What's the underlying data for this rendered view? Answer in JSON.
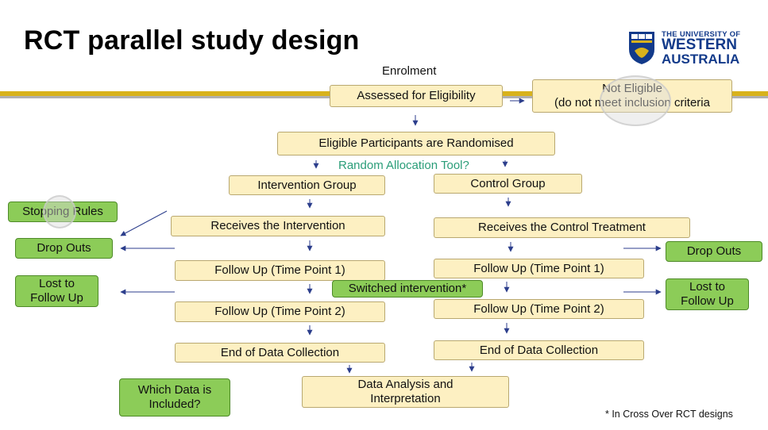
{
  "title": "RCT parallel study design",
  "logo": {
    "line1": "THE UNIVERSITY OF",
    "line2": "WESTERN",
    "line3": "AUSTRALIA"
  },
  "flow": {
    "enrolment": "Enrolment",
    "assessed": "Assessed for Eligibility",
    "not_eligible_1": "Not Eligible",
    "not_eligible_2": "(do not meet inclusion criteria",
    "randomised": "Eligible Participants are Randomised",
    "random_tool": "Random Allocation Tool?",
    "intervention_group": "Intervention Group",
    "control_group": "Control Group",
    "receives_intervention": "Receives the Intervention",
    "receives_control": "Receives the Control Treatment",
    "follow_up_1_left": "Follow Up (Time Point 1)",
    "follow_up_1_right": "Follow Up (Time Point 1)",
    "switched": "Switched intervention*",
    "follow_up_2_left": "Follow Up (Time Point 2)",
    "follow_up_2_right": "Follow Up (Time Point 2)",
    "end_left": "End of Data Collection",
    "end_right": "End of Data Collection",
    "analysis_1": "Data Analysis and",
    "analysis_2": "Interpretation"
  },
  "side": {
    "stopping_rules": "Stopping Rules",
    "drop_outs_left": "Drop Outs",
    "lost_left_1": "Lost to",
    "lost_left_2": "Follow Up",
    "drop_outs_right": "Drop Outs",
    "lost_right_1": "Lost to",
    "lost_right_2": "Follow Up",
    "which_data_1": "Which Data is",
    "which_data_2": "Included?"
  },
  "footnote": "* In Cross Over RCT designs",
  "colors": {
    "cream": "#fdf0c2",
    "green": "#8ccc58",
    "gold": "#d8b21c",
    "arrow": "#2c3e8c",
    "teal": "#2a9d78"
  }
}
